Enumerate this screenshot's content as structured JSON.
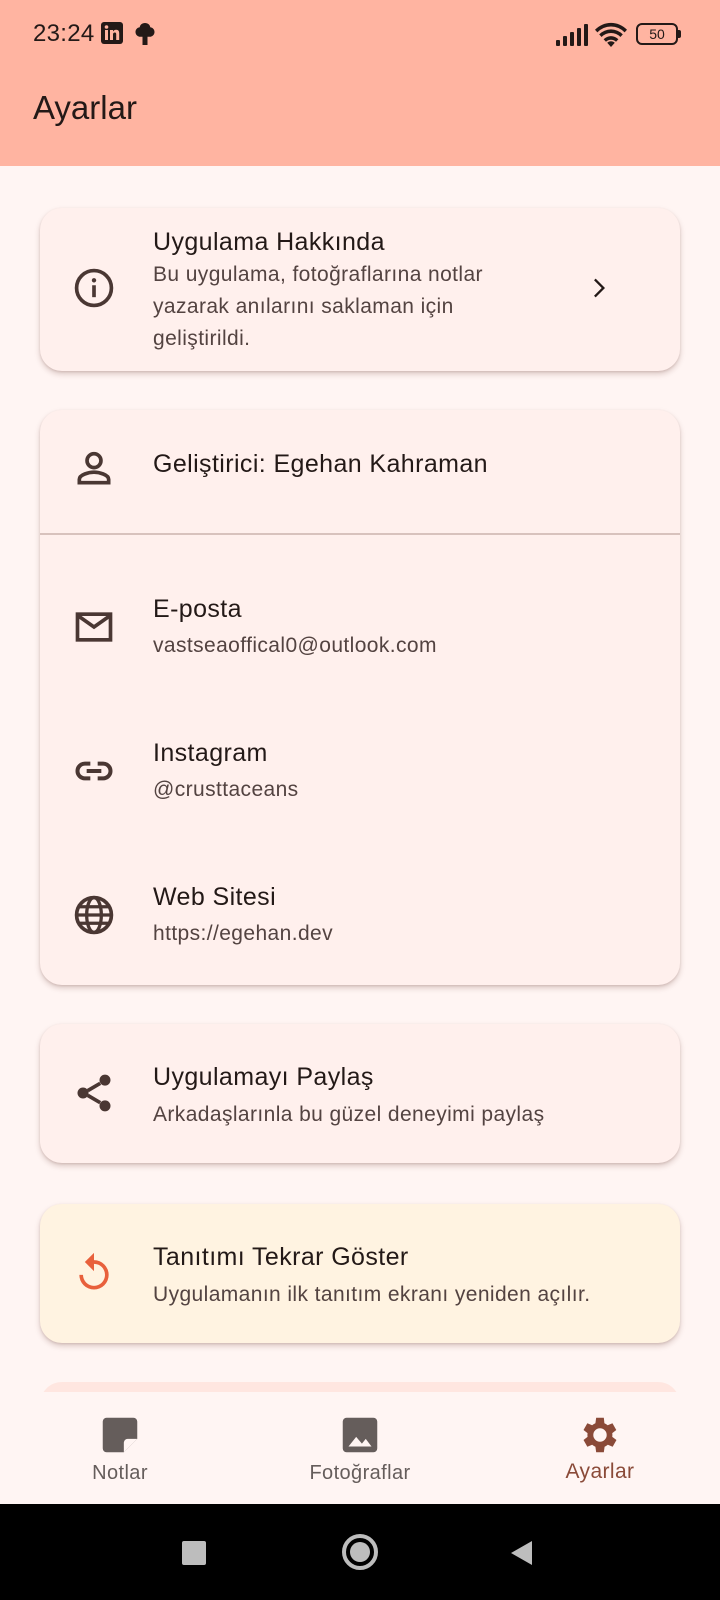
{
  "status_bar": {
    "time": "23:24",
    "left_icons": [
      "linkedin-icon",
      "tree-icon"
    ],
    "right_icons": [
      "signal-icon",
      "wifi-icon",
      "battery-icon"
    ],
    "battery": "50"
  },
  "app_bar": {
    "title": "Ayarlar"
  },
  "about_card": {
    "title": "Uygulama Hakkında",
    "description_lines": [
      "Bu uygulama, fotoğraflarına notlar",
      "yazarak anılarını saklaman için",
      "geliştirildi."
    ],
    "icon": "info-icon",
    "trailing_icon": "chevron-right-icon"
  },
  "developer_card": {
    "developer": {
      "label": "Geliştirici: Egehan Kahraman",
      "icon": "person-icon"
    },
    "email": {
      "title": "E-posta",
      "value": "vastseaoffical0@outlook.com",
      "icon": "mail-icon"
    },
    "instagram": {
      "title": "Instagram",
      "value": "@crusttaceans",
      "icon": "link-icon"
    },
    "website": {
      "title": "Web Sitesi",
      "value": "https://egehan.dev",
      "icon": "globe-icon"
    }
  },
  "share_card": {
    "title": "Uygulamayı Paylaş",
    "subtitle": "Arkadaşlarınla bu güzel deneyimi paylaş",
    "icon": "share-icon"
  },
  "intro_card": {
    "title": "Tanıtımı Tekrar Göster",
    "subtitle": "Uygulamanın ilk tanıtım ekranı yeniden açılır.",
    "icon": "replay-icon",
    "accent": "#e8603c"
  },
  "bottom_nav": {
    "items": [
      {
        "label": "Notlar",
        "icon": "note-icon",
        "active": false
      },
      {
        "label": "Fotoğraflar",
        "icon": "image-icon",
        "active": false
      },
      {
        "label": "Ayarlar",
        "icon": "gear-icon",
        "active": true
      }
    ]
  },
  "system_nav": {
    "icons": [
      "recents-square-icon",
      "home-circle-icon",
      "back-triangle-icon"
    ]
  },
  "colors": {
    "app_bar": "#ffb4a1",
    "background": "#fff5f3",
    "card": "#fff0ed",
    "card_highlight": "#fff3e1",
    "active_nav": "#8a4a38"
  }
}
